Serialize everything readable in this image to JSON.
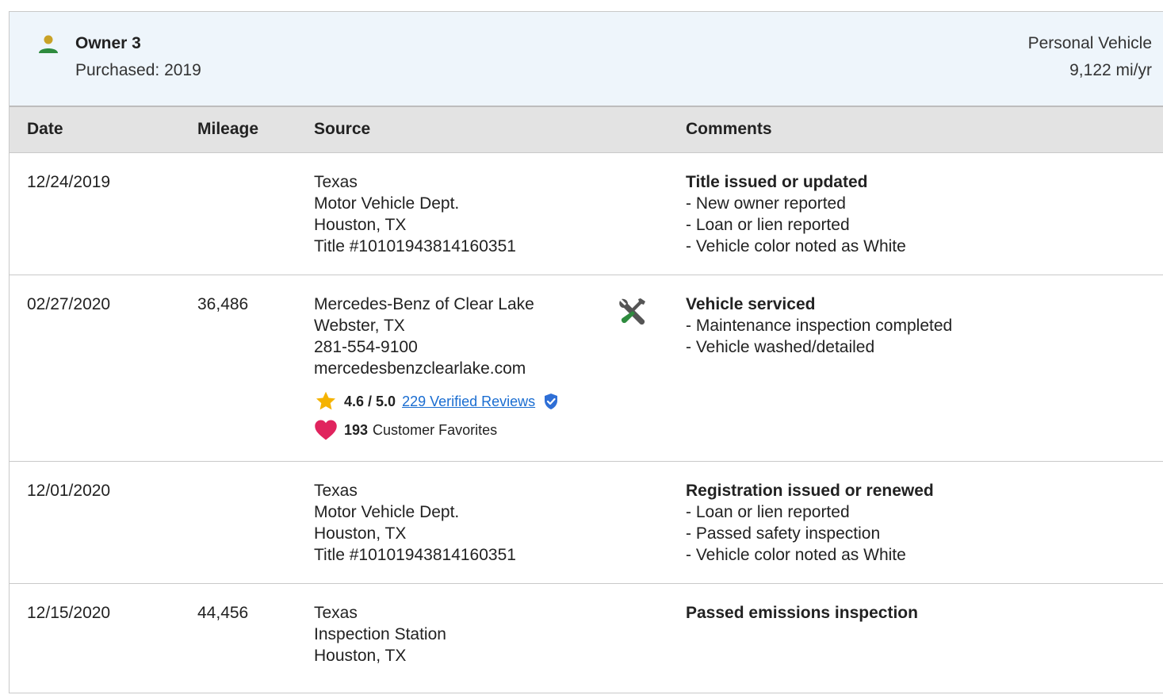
{
  "owner": {
    "name": "Owner 3",
    "purchased": "Purchased: 2019",
    "vehicle_type": "Personal Vehicle",
    "miles_per_year": "9,122 mi/yr",
    "icon": "person-icon",
    "icon_colors": {
      "head": "#c9a227",
      "body": "#2e8b3e"
    }
  },
  "table": {
    "headers": {
      "date": "Date",
      "mileage": "Mileage",
      "source": "Source",
      "comments": "Comments"
    }
  },
  "records": [
    {
      "date": "12/24/2019",
      "mileage": "",
      "source": [
        "Texas",
        "Motor Vehicle Dept.",
        "Houston, TX",
        "Title #10101943814160351"
      ],
      "comment_title": "Title issued or updated",
      "comment_items": [
        "New owner reported",
        "Loan or lien reported",
        "Vehicle color noted as White"
      ]
    },
    {
      "date": "02/27/2020",
      "mileage": "36,486",
      "source": [
        "Mercedes-Benz of Clear Lake",
        "Webster, TX",
        "281-554-9100",
        "mercedesbenzclearlake.com"
      ],
      "service_icon": "wrench-screwdriver-icon",
      "rating": {
        "value": "4.6 / 5.0",
        "reviews_link": "229 Verified Reviews",
        "favorites_count": "193",
        "favorites_label": "Customer Favorites"
      },
      "comment_title": "Vehicle serviced",
      "comment_items": [
        "Maintenance inspection completed",
        "Vehicle washed/detailed"
      ]
    },
    {
      "date": "12/01/2020",
      "mileage": "",
      "source": [
        "Texas",
        "Motor Vehicle Dept.",
        "Houston, TX",
        "Title #10101943814160351"
      ],
      "comment_title": "Registration issued or renewed",
      "comment_items": [
        "Loan or lien reported",
        "Passed safety inspection",
        "Vehicle color noted as White"
      ]
    },
    {
      "date": "12/15/2020",
      "mileage": "44,456",
      "source": [
        "Texas",
        "Inspection Station",
        "Houston, TX"
      ],
      "comment_title": "Passed emissions inspection",
      "comment_items": []
    }
  ],
  "colors": {
    "header_bg": "#eef5fb",
    "table_head_bg": "#e3e3e3",
    "link": "#1a6dd1",
    "star": "#f5b301",
    "heart": "#e0245e",
    "verified": "#2f6fd6",
    "service_icon_green": "#2e8b3e",
    "service_icon_gray": "#555555"
  }
}
